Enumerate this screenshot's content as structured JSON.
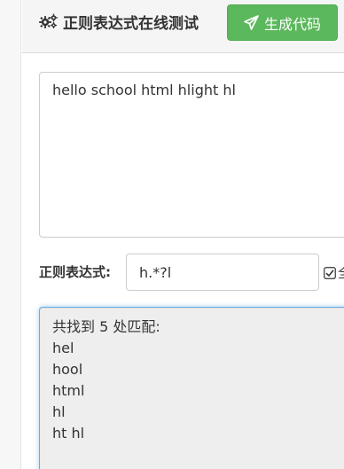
{
  "header": {
    "title": "正则表达式在线测试",
    "title_icon": "gears-icon",
    "generate_button_label": "生成代码",
    "generate_button_icon": "send-icon",
    "generate_button_color": "#5cb85c"
  },
  "input": {
    "text": "hello school html hlight hl"
  },
  "regex": {
    "label": "正则表达式:",
    "value": "h.*?l",
    "global_label": "全",
    "global_checked": true
  },
  "result": {
    "summary": "共找到 5 处匹配:",
    "matches": [
      "hel",
      "hool",
      "html",
      "hl",
      "ht hl"
    ]
  }
}
